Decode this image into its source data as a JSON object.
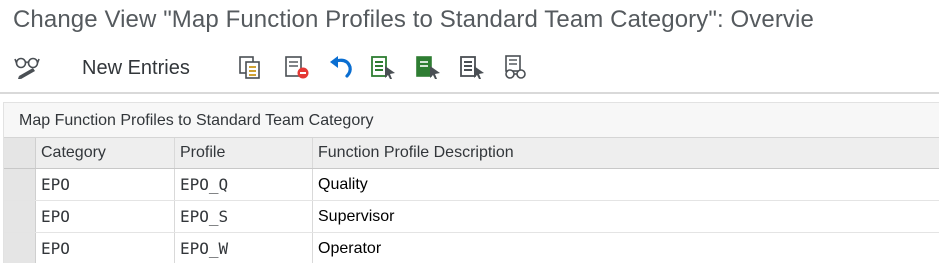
{
  "window": {
    "title": "Change View \"Map Function Profiles to Standard Team Category\": Overvie"
  },
  "toolbar": {
    "new_entries_label": "New Entries",
    "icons": [
      "display-change-icon",
      "copy-icon",
      "delete-icon",
      "undo-icon",
      "select-all-icon",
      "select-block-icon",
      "deselect-all-icon",
      "detail-view-icon"
    ]
  },
  "panel": {
    "title": "Map Function Profiles to Standard Team Category"
  },
  "table": {
    "headers": {
      "category": "Category",
      "profile": "Profile",
      "description": "Function Profile Description"
    },
    "rows": [
      {
        "category": "EPO",
        "profile": "EPO_Q",
        "description": "Quality"
      },
      {
        "category": "EPO",
        "profile": "EPO_S",
        "description": "Supervisor"
      },
      {
        "category": "EPO",
        "profile": "EPO_W",
        "description": "Operator"
      }
    ]
  },
  "colors": {
    "accent_blue": "#0a6ed1",
    "delete_red": "#e53935",
    "select_green": "#2e7d32"
  }
}
